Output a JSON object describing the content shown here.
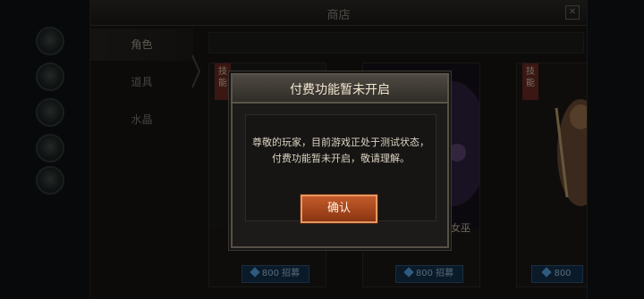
{
  "shop": {
    "title": "商店",
    "close_icon": "close-icon",
    "nav": [
      {
        "label": "角色",
        "active": true
      },
      {
        "label": "道具",
        "active": false
      },
      {
        "label": "水晶",
        "active": false
      }
    ],
    "cards": [
      {
        "badge": "技能",
        "name": "",
        "price": "800 招募"
      },
      {
        "badge": "",
        "name": "女巫",
        "price": "800 招募"
      },
      {
        "badge": "技能",
        "name": "",
        "price": "800"
      }
    ]
  },
  "dialog": {
    "title": "付费功能暂未开启",
    "message": "尊敬的玩家，目前游戏正处于测试状态，付费功能暂未开启，敬请理解。",
    "confirm_label": "确认"
  },
  "colors": {
    "confirm_button": "#b5491f",
    "price_button": "#143049",
    "badge": "#6b2a22"
  }
}
